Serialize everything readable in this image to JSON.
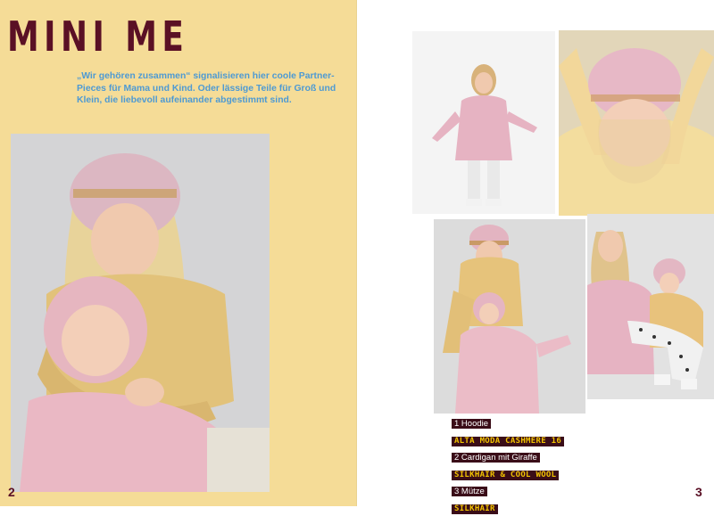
{
  "left_page": {
    "title": "MINI ME",
    "intro": "„Wir gehören zusammen“ signalisieren hier coole Partner-Pieces für Mama und Kind. Oder lässige Teile für Groß und Klein, die liebevoll aufeinander abgestimmt sind.",
    "page_number": "2"
  },
  "right_page": {
    "page_number": "3",
    "captions": [
      {
        "item": "1 Hoodie",
        "yarn": "ALTA MODA CASHMERE 16"
      },
      {
        "item": "2 Cardigan mit Giraffe",
        "yarn": "SILKHAIR & COOL WOOL"
      },
      {
        "item": "3 Mütze",
        "yarn": "SILKHAIR"
      }
    ]
  },
  "colors": {
    "left_background": "#f5dc97",
    "title": "#5a1025",
    "intro_text": "#4e9ad3",
    "caption_box": "#3a0d18",
    "caption_yarn": "#f2c400"
  }
}
